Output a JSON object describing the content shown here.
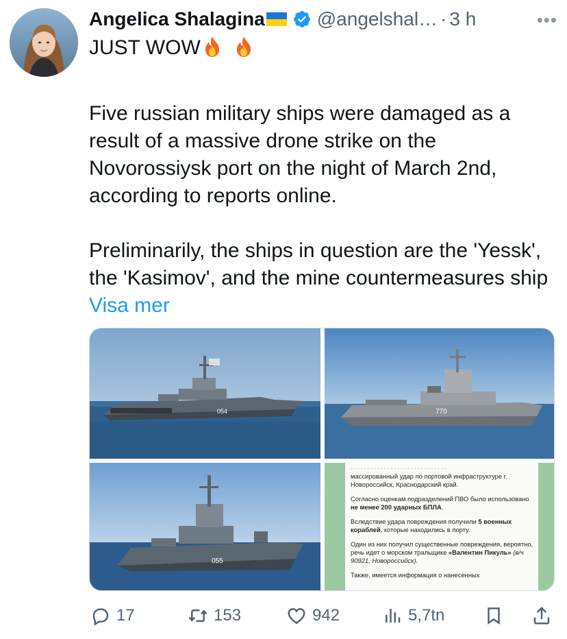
{
  "author": {
    "name": "Angelica Shalagina",
    "handle": "@angelshal…",
    "separator": "·",
    "time": "3 h"
  },
  "tweet": {
    "line1": "JUST WOW",
    "para1": "Five russian military ships were damaged as a result of a massive drone strike on the Novorossiysk port on the night of March 2nd, according to reports online.",
    "para2": "Preliminarily, the ships in question are the 'Yessk', the 'Kasimov', and the mine countermeasures ship",
    "show_more": "Visa mer"
  },
  "media": {
    "ship1_hull": "054",
    "ship2_hull": "770",
    "ship3_hull": "055",
    "document": {
      "p1": "массированный удар по портовой инфраструктуре г. Новороссийск, Краснодарский край.",
      "p2a": "Согласно оценкам подразделений ПВО было использовано ",
      "p2b": "не менее 200 ударных БПЛА",
      "p2c": ".",
      "p3a": "Вследствие удара повреждения получили ",
      "p3b": "5 военных кораблей",
      "p3c": ", которые находились в порту.",
      "p4a": "Один из них получил существенные повреждения, вероятно, речь идет о морском тральщике ",
      "p4b": "«Валентин Пикуль»",
      "p4c": " (в/ч 90921, Новороссийск).",
      "p5": "Также, имеется информация о нанесенных"
    }
  },
  "actions": {
    "replies": "17",
    "reposts": "153",
    "likes": "942",
    "views": "5,7tn"
  },
  "icons": [
    "verified-badge-icon",
    "ukraine-flag-icon",
    "fire-icon",
    "more-icon",
    "reply-icon",
    "repost-icon",
    "like-icon",
    "views-icon",
    "bookmark-icon",
    "share-icon"
  ],
  "colors": {
    "link": "#1d9bf0",
    "verified": "#1d9bf0",
    "muted": "#536471",
    "text": "#0f1419"
  }
}
